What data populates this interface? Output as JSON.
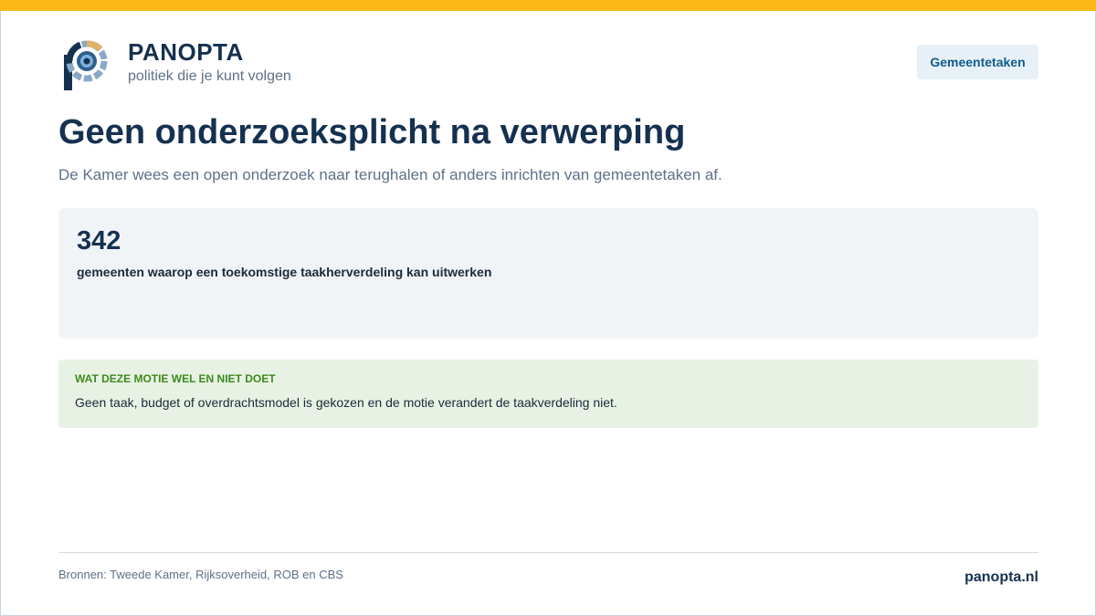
{
  "colors": {
    "accent_bar": "#f9b818",
    "brand_navy": "#163150",
    "muted_text": "#5d7189",
    "button_bg": "#e7f0f7",
    "button_text": "#0f5c8a",
    "stat_bg": "#f1f4f7",
    "note_bg": "#e8f2e4",
    "note_heading": "#3d8a1d"
  },
  "header": {
    "logo_icon": "panopta-eye-logo-icon",
    "brand_name": "PANOPTA",
    "tagline": "politiek die je kunt volgen",
    "topic_button_label": "Gemeentetaken"
  },
  "main": {
    "title": "Geen onderzoeksplicht na verwerping",
    "subtitle": "De Kamer wees een open onderzoek naar terughalen of anders inrichten van gemeentetaken af.",
    "stat": {
      "value": "342",
      "label": "gemeenten waarop een toekomstige taakherverdeling kan uitwerken"
    },
    "note": {
      "heading": "WAT DEZE MOTIE WEL EN NIET DOET",
      "text": "Geen taak, budget of overdrachtsmodel is gekozen en de motie verandert de taakverdeling niet."
    }
  },
  "footer": {
    "sources": "Bronnen: Tweede Kamer, Rijksoverheid, ROB en CBS",
    "site": "panopta.nl"
  }
}
